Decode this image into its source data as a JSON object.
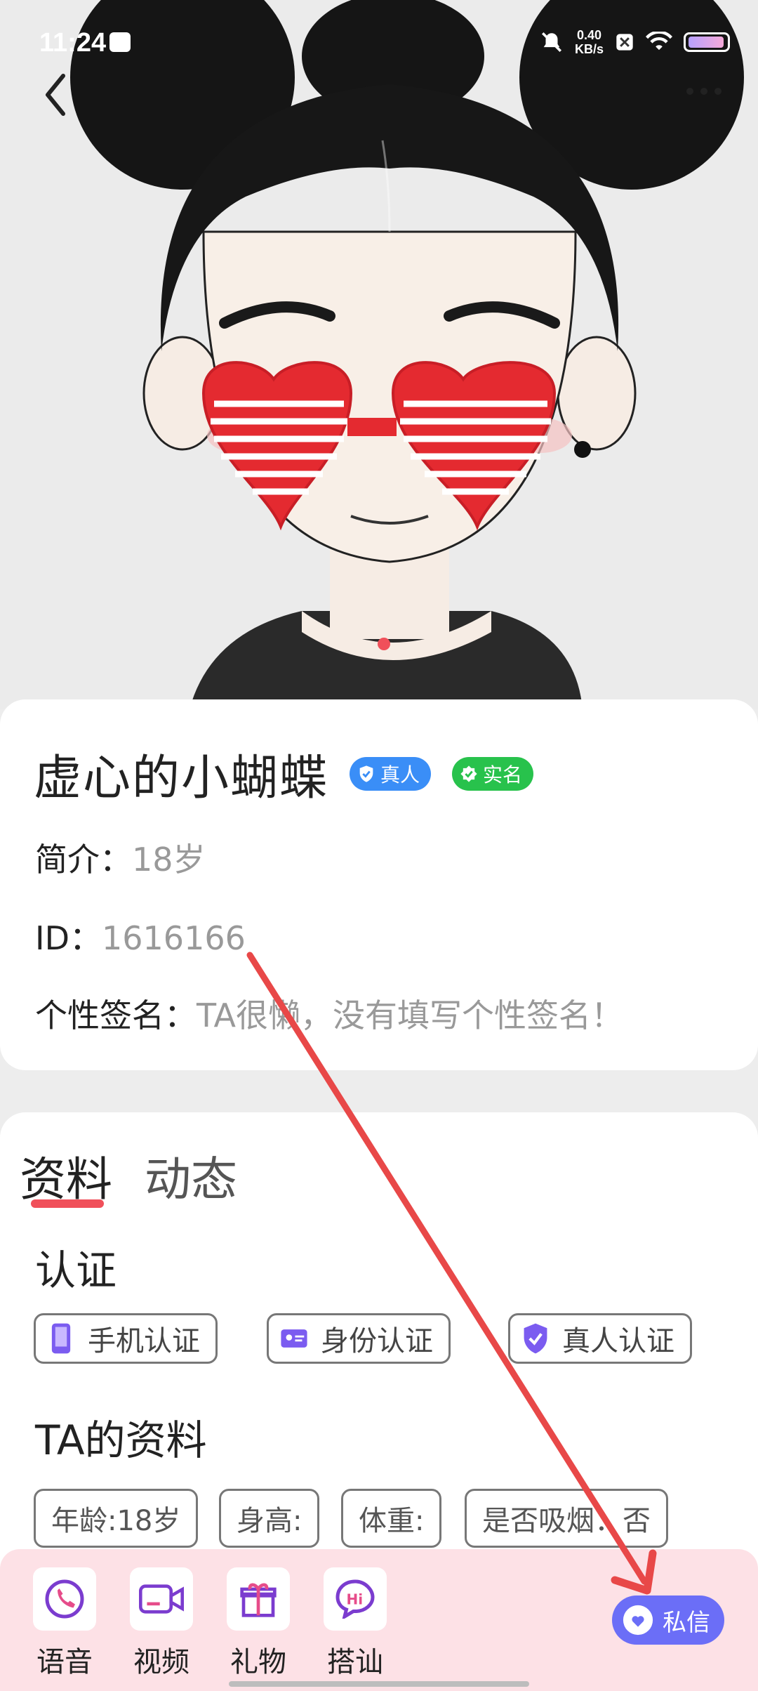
{
  "status_bar": {
    "time": "11:24",
    "speed_value": "0.40",
    "speed_unit": "KB/s"
  },
  "profile": {
    "name": "虚心的小蝴蝶",
    "badges": [
      "真人",
      "实名"
    ],
    "intro_label": "简介：",
    "intro_value": "18岁",
    "id_label": "ID：",
    "id_value": "1616166",
    "signature_label": "个性签名：",
    "signature_value": "TA很懒，没有填写个性签名！"
  },
  "tabs": {
    "active": "资料",
    "inactive": "动态"
  },
  "certification": {
    "title": "认证",
    "items": [
      "手机认证",
      "身份认证",
      "真人认证"
    ]
  },
  "ta_profile": {
    "title": "TA的资料",
    "chips": [
      "年龄:18岁",
      "身高:",
      "体重:",
      "是否吸烟：否"
    ]
  },
  "bottom_actions": [
    "语音",
    "视频",
    "礼物",
    "搭讪"
  ],
  "dm_button": "私信",
  "colors": {
    "accent_red": "#f0505a",
    "dm_purple": "#6b6ef7",
    "bottom_bg": "#fde1e6"
  }
}
